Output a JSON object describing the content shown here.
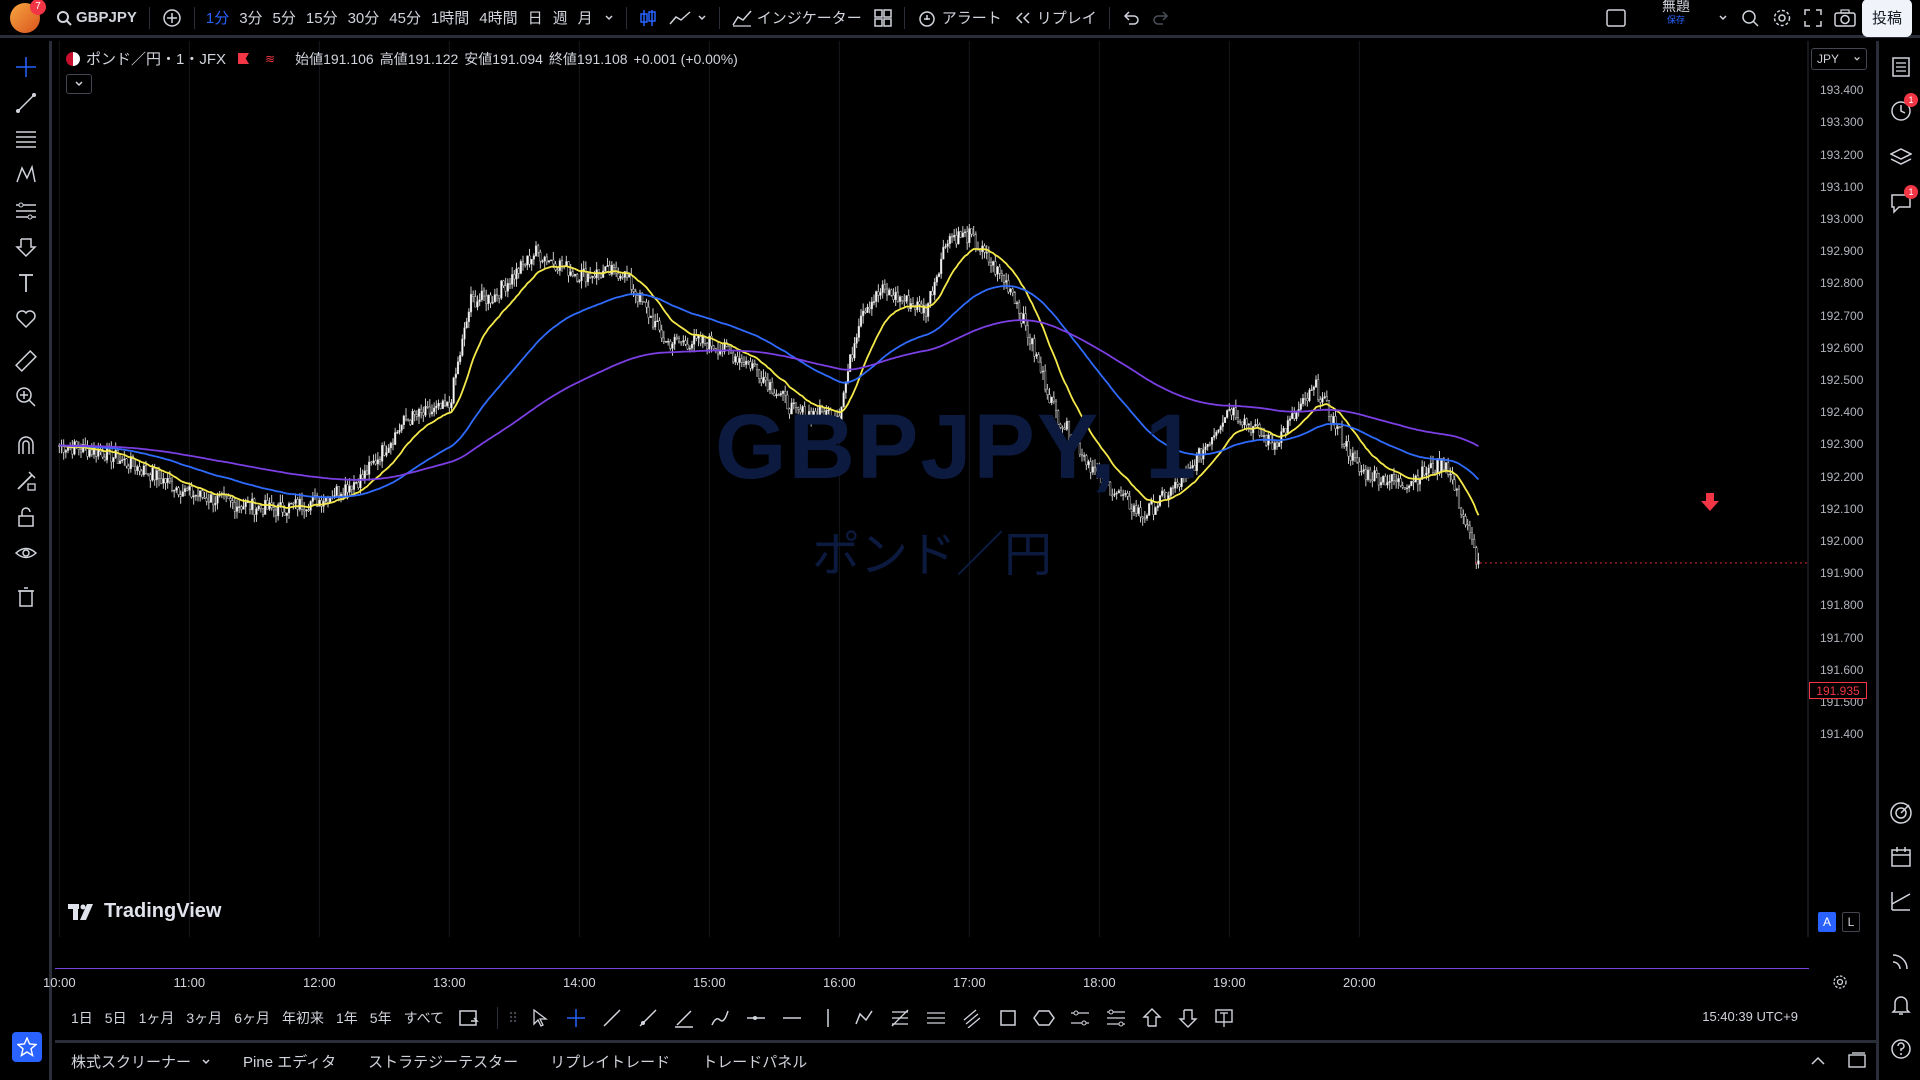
{
  "topbar": {
    "avatar_badge": "7",
    "symbol": "GBPJPY",
    "intervals": [
      "1分",
      "3分",
      "5分",
      "15分",
      "30分",
      "45分",
      "1時間",
      "4時間",
      "日",
      "週",
      "月"
    ],
    "active_interval": "1分",
    "indicators_label": "インジケーター",
    "alert_label": "アラート",
    "replay_label": "リプレイ",
    "layout_name": "無題",
    "layout_status": "保存",
    "post_label": "投稿"
  },
  "legend": {
    "title": "ポンド／円・1・JFX",
    "open_label": "始値",
    "open": "191.106",
    "high_label": "高値",
    "high": "191.122",
    "low_label": "安値",
    "low": "191.094",
    "close_label": "終値",
    "close": "191.108",
    "change": "+0.001 (+0.00%)"
  },
  "watermark": {
    "symbol": "GBPJPY, 1",
    "name": "ポンド／円"
  },
  "brand": "TradingView",
  "price_axis": {
    "currency": "JPY",
    "labels": [
      "193.400",
      "193.300",
      "193.200",
      "193.100",
      "193.000",
      "192.900",
      "192.800",
      "192.700",
      "192.600",
      "192.500",
      "192.400",
      "192.300",
      "192.200",
      "192.100",
      "192.000",
      "191.900",
      "191.800",
      "191.700",
      "191.600",
      "191.500",
      "191.400"
    ],
    "current_price": "191.935",
    "auto_label": "A",
    "log_label": "L"
  },
  "time_axis": {
    "labels": [
      "10:00",
      "11:00",
      "12:00",
      "13:00",
      "14:00",
      "15:00",
      "16:00",
      "17:00",
      "18:00",
      "19:00",
      "20:00"
    ]
  },
  "range_buttons": [
    "1日",
    "5日",
    "1ヶ月",
    "3ヶ月",
    "6ヶ月",
    "年初来",
    "1年",
    "5年",
    "すべて"
  ],
  "clock": "15:40:39 UTC+9",
  "bottom_tabs": [
    "株式スクリーナー",
    "Pine エディタ",
    "ストラテジーテスター",
    "リプレイトレード",
    "トレードパネル"
  ],
  "right_badges": {
    "alerts": "1",
    "chat": "1"
  },
  "colors": {
    "ma_fast": "#f5e94a",
    "ma_mid": "#2f6bff",
    "ma_slow": "#7b3fe4",
    "accent": "#2962ff",
    "down_arrow": "#f23645"
  },
  "chart_data": {
    "type": "candlestick",
    "symbol": "GBPJPY",
    "interval": "1分",
    "ylim": [
      191.35,
      193.45
    ],
    "x_start": "09:58",
    "x_end": "20:57",
    "series": [
      {
        "name": "close",
        "t": [
          "10:00",
          "10:20",
          "10:40",
          "11:00",
          "11:20",
          "11:40",
          "12:00",
          "12:20",
          "12:40",
          "13:00",
          "13:10",
          "13:20",
          "13:40",
          "14:00",
          "14:20",
          "14:40",
          "15:00",
          "15:20",
          "15:40",
          "16:00",
          "16:10",
          "16:20",
          "16:40",
          "16:50",
          "17:00",
          "17:20",
          "17:40",
          "18:00",
          "18:20",
          "18:40",
          "19:00",
          "19:20",
          "19:40",
          "20:00",
          "20:20",
          "20:40",
          "20:55"
        ],
        "values": [
          192.3,
          192.28,
          192.22,
          192.15,
          192.12,
          192.1,
          192.13,
          192.2,
          192.38,
          192.42,
          192.75,
          192.76,
          192.9,
          192.83,
          192.84,
          192.62,
          192.62,
          192.55,
          192.4,
          192.4,
          192.72,
          192.78,
          192.72,
          192.95,
          192.95,
          192.78,
          192.4,
          192.2,
          192.08,
          192.2,
          192.42,
          192.3,
          192.48,
          192.22,
          192.18,
          192.25,
          191.93
        ]
      },
      {
        "name": "ma_fast"
      },
      {
        "name": "ma_mid"
      },
      {
        "name": "ma_slow"
      }
    ]
  }
}
